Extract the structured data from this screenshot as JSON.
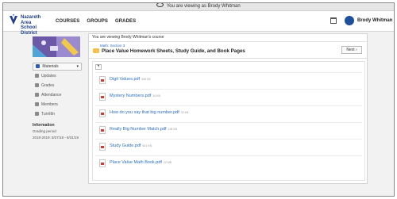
{
  "viewing_bar": {
    "text": "You are viewing as Brody Whitman"
  },
  "nav": {
    "school_name_1": "Nazareth Area",
    "school_name_2": "School District",
    "links": [
      "COURSES",
      "GROUPS",
      "GRADES"
    ],
    "user_name": "Brody Whitman"
  },
  "sidebar": {
    "materials_label": "Materials",
    "items": [
      "Updates",
      "Grades",
      "Attendance",
      "Members",
      "TurnItIn"
    ],
    "info_heading": "Information",
    "grading_period_label": "Grading period",
    "grading_period_value": "2018-2019: 8/27/18 - 5/31/19"
  },
  "main": {
    "viewing_course": "You are viewing Brody Whitman's course",
    "breadcrumb": "Math: Section 3",
    "title": "Place Value Homework Sheets, Study Guide, and Book Pages",
    "next_label": "Next",
    "back_label": "↰",
    "files": [
      {
        "name": "Digit Values.pdf",
        "size": "308 KB"
      },
      {
        "name": "Mystery Numbers.pdf",
        "size": "34 KB"
      },
      {
        "name": "How do you say that big number.pdf",
        "size": "32 KB"
      },
      {
        "name": "Really Big Number Match.pdf",
        "size": "228 KB"
      },
      {
        "name": "Study Guide.pdf",
        "size": "621 KB"
      },
      {
        "name": "Place Value Math Book.pdf",
        "size": "12 MB"
      }
    ]
  },
  "colors": {
    "brand_blue": "#1e4f9a",
    "link_blue": "#2a6ec4",
    "folder_yellow": "#f5c04b",
    "pdf_red": "#d63a2f"
  }
}
